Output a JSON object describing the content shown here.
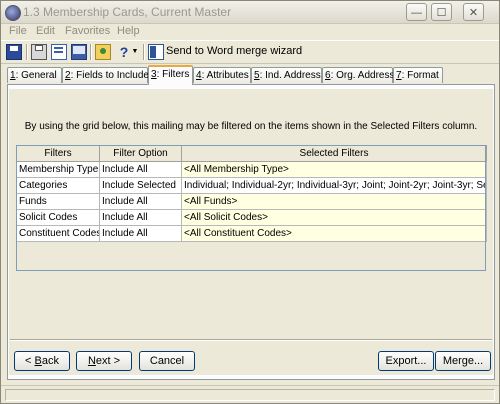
{
  "window": {
    "title": "1.3 Membership Cards, Current Master"
  },
  "menu": [
    "File",
    "Edit",
    "Favorites",
    "Help"
  ],
  "toolbar": {
    "merge_wizard_label": "Send to Word merge wizard"
  },
  "tabs": [
    {
      "key": "1",
      "label": ": General"
    },
    {
      "key": "2",
      "label": ": Fields to Include"
    },
    {
      "key": "3",
      "label": ": Filters"
    },
    {
      "key": "4",
      "label": ": Attributes"
    },
    {
      "key": "5",
      "label": ": Ind. Address"
    },
    {
      "key": "6",
      "label": ": Org. Address"
    },
    {
      "key": "7",
      "label": ": Format"
    }
  ],
  "filters_tab": {
    "description": "By using the grid below, this mailing may be filtered on the items shown in the Selected Filters column.",
    "columns": [
      "Filters",
      "Filter Option",
      "Selected Filters"
    ],
    "rows": [
      [
        "Membership Type",
        "Include All",
        "<All Membership Type>"
      ],
      [
        "Categories",
        "Include Selected",
        "Individual; Individual-2yr; Individual-3yr; Joint; Joint-2yr; Joint-3yr; Se..."
      ],
      [
        "Funds",
        "Include All",
        "<All Funds>"
      ],
      [
        "Solicit Codes",
        "Include All",
        "<All Solicit Codes>"
      ],
      [
        "Constituent Codes",
        "Include All",
        "<All Constituent Codes>"
      ]
    ]
  },
  "buttons": {
    "back": {
      "mnemonic": "B",
      "rest": "ack",
      "prefix": "< "
    },
    "next": {
      "mnemonic": "N",
      "rest": "ext >"
    },
    "cancel": "Cancel",
    "export": "Export...",
    "merge": "Merge..."
  }
}
